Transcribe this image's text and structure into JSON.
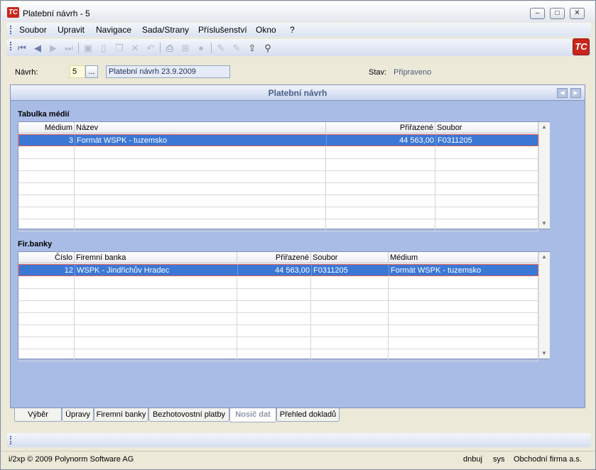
{
  "window": {
    "title": "Platební návrh - 5",
    "app_icon": "TC"
  },
  "menu": [
    "Soubor",
    "Upravit",
    "Navigace",
    "Sada/Strany",
    "Příslušenství",
    "Okno",
    "?"
  ],
  "form": {
    "navrh_label": "Návrh:",
    "navrh_value": "5",
    "browse_label": "...",
    "description": "Platební návrh 23.9.2009",
    "stav_label": "Stav:",
    "stav_value": "Připraveno"
  },
  "panel": {
    "title": "Platební návrh"
  },
  "media": {
    "title": "Tabulka médií",
    "columns": [
      "Médium",
      "Název",
      "Přiřazené",
      "Soubor"
    ],
    "rows": [
      {
        "medium": "3",
        "nazev": "Formát WSPK - tuzemsko",
        "prirazene": "44 563,00",
        "soubor": "F0311205"
      }
    ]
  },
  "banks": {
    "title": "Fir.banky",
    "columns": [
      "Číslo",
      "Firemní banka",
      "Přiřazené",
      "Soubor",
      "Médium"
    ],
    "rows": [
      {
        "cislo": "12",
        "banka": "WSPK - Jindřichův Hradec",
        "prirazene": "44 563,00",
        "soubor": "F0311205",
        "medium": "Formát WSPK - tuzemsko"
      }
    ]
  },
  "tabs": [
    "Výběr",
    "Úpravy",
    "Firemní banky",
    "Bezhotovostní platby",
    "Nosič dat",
    "Přehled dokladů"
  ],
  "active_tab": "Nosič dat",
  "footer": {
    "copyright": "i/2xp © 2009 Polynorm Software AG",
    "db": "dnbuj",
    "user": "sys",
    "company": "Obchodní firma a.s."
  }
}
